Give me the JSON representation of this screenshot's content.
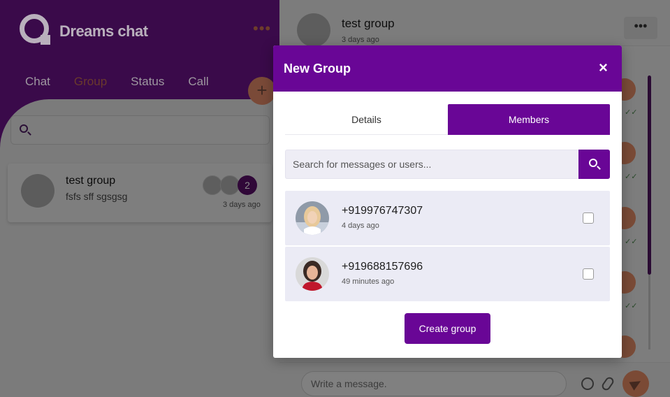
{
  "app": {
    "brand": "Dreams chat"
  },
  "sidebar": {
    "menu_icon": "more-dots-icon",
    "tabs": [
      {
        "label": "Chat"
      },
      {
        "label": "Group",
        "active": true
      },
      {
        "label": "Status"
      },
      {
        "label": "Call"
      }
    ],
    "add_icon": "plus-icon",
    "search": {
      "icon": "search-icon",
      "placeholder": ""
    },
    "conversations": [
      {
        "name": "test group",
        "last_message": "fsfs sff sgsgsg",
        "member_count": "2",
        "time": "3 days ago"
      }
    ]
  },
  "chat": {
    "title": "test group",
    "subtitle": "3 days ago",
    "more_icon": "more-dots-icon",
    "composer": {
      "placeholder": "Write a message.",
      "emoji_icon": "smile-icon",
      "attach_icon": "paperclip-icon",
      "send_icon": "send-icon"
    }
  },
  "modal": {
    "title": "New Group",
    "close_label": "×",
    "tabs": [
      {
        "label": "Details"
      },
      {
        "label": "Members",
        "active": true
      }
    ],
    "search": {
      "placeholder": "Search for messages or users...",
      "icon": "search-icon"
    },
    "members": [
      {
        "phone": "+919976747307",
        "time": "4 days ago",
        "checked": false
      },
      {
        "phone": "+919688157696",
        "time": "49 minutes ago",
        "checked": false
      }
    ],
    "create_label": "Create group"
  },
  "colors": {
    "primary": "#690696",
    "accent": "#f08a5d",
    "modal_bg": "#ffffff",
    "row_bg": "#ebebf5"
  }
}
